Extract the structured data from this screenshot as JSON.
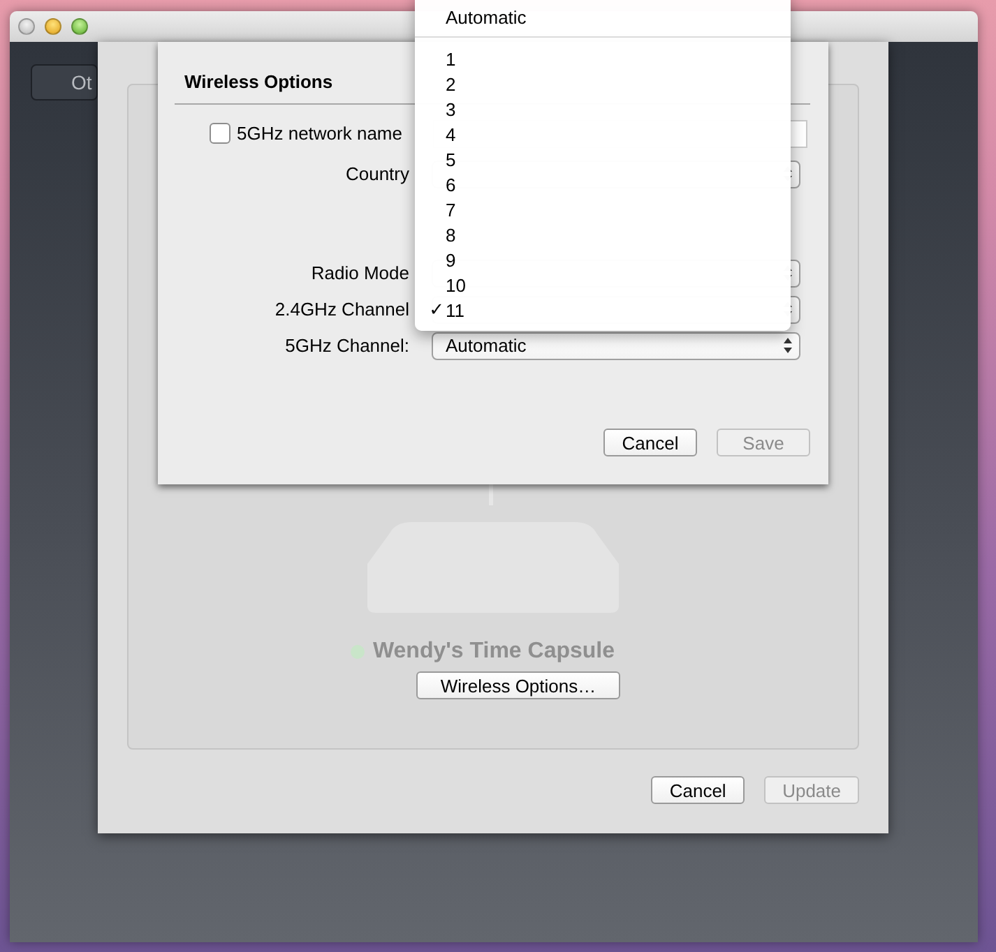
{
  "sidebar": {
    "button": "Ot"
  },
  "device": {
    "name": "Wendy's Time Capsule"
  },
  "base": {
    "options_button": "Wireless Options…",
    "buttons": [
      {
        "label": "Cancel",
        "disabled": false
      },
      {
        "label": "Update",
        "disabled": true
      }
    ]
  },
  "sheet": {
    "title": "Wireless Options",
    "upper_rows": [
      {
        "kind": "checkbox",
        "label": "5GHz network name",
        "checked": false
      },
      {
        "kind": "popup",
        "label": "Country"
      }
    ],
    "lower_rows": [
      {
        "kind": "popup",
        "label": "Radio Mode"
      },
      {
        "kind": "popup",
        "label": "2.4GHz Channel"
      },
      {
        "kind": "popup",
        "label": "5GHz Channel:",
        "value": "Automatic"
      }
    ],
    "buttons": [
      {
        "label": "Cancel",
        "disabled": false
      },
      {
        "label": "Save",
        "disabled": true
      }
    ]
  },
  "menu": {
    "check_mark": "✓",
    "top_item": {
      "label": "Automatic",
      "selected": false
    },
    "items": [
      {
        "label": "1",
        "selected": false
      },
      {
        "label": "2",
        "selected": false
      },
      {
        "label": "3",
        "selected": false
      },
      {
        "label": "4",
        "selected": false
      },
      {
        "label": "5",
        "selected": false
      },
      {
        "label": "6",
        "selected": false
      },
      {
        "label": "7",
        "selected": false
      },
      {
        "label": "8",
        "selected": false
      },
      {
        "label": "9",
        "selected": false
      },
      {
        "label": "10",
        "selected": false
      },
      {
        "label": "11",
        "selected": true
      }
    ]
  }
}
